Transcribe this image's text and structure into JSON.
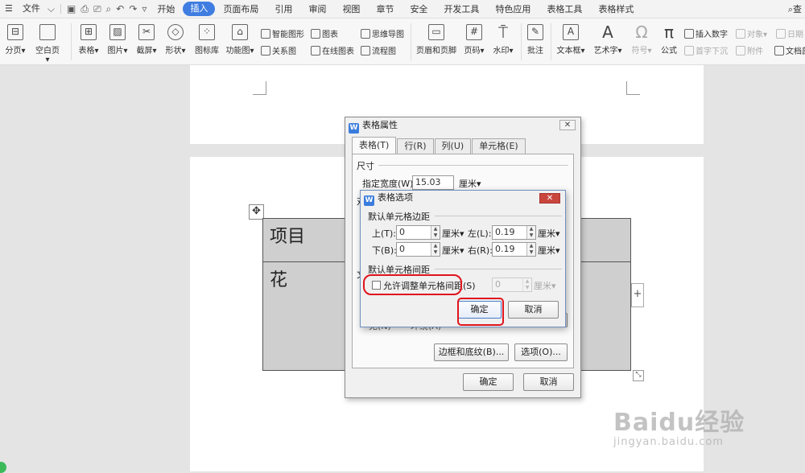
{
  "menubar": {
    "hamburger_icon": "menu-icon",
    "file_menu": "文件",
    "tabs": [
      "开始",
      "插入",
      "页面布局",
      "引用",
      "审阅",
      "视图",
      "章节",
      "安全",
      "开发工具",
      "特色应用",
      "表格工具",
      "表格样式"
    ],
    "active_tab": "插入",
    "search_label": "查"
  },
  "ribbon": {
    "page_break": "分页",
    "blank_page": "空白页",
    "table": "表格",
    "picture": "图片",
    "screenshot": "截屏",
    "shapes": "形状",
    "icon_library": "图标库",
    "function_chart": "功能图",
    "smart_shape": "智能图形",
    "chart": "图表",
    "relation_chart": "关系图",
    "online_chart": "在线图表",
    "mind_map": "思维导图",
    "flowchart": "流程图",
    "header_footer": "页眉和页脚",
    "page_number": "页码",
    "watermark": "水印",
    "comment": "批注",
    "text_box": "文本框",
    "art_text": "艺术字",
    "symbol": "符号",
    "formula": "公式",
    "insert_number": "插入数字",
    "drop_cap": "首字下沉",
    "object": "对象",
    "attachment": "附件",
    "date": "日期",
    "doc_part": "文档部"
  },
  "document": {
    "table_cell_1": "项目",
    "table_cell_2": "花"
  },
  "table_properties": {
    "title": "表格属性",
    "tabs": [
      "表格(T)",
      "行(R)",
      "列(U)",
      "单元格(E)"
    ],
    "size_label": "尺寸",
    "width_label": "指定宽度(W):",
    "width_value": "15.03",
    "width_unit": "厘米▾",
    "truncated_label_1": "对",
    "truncated_label_2": "文",
    "truncated_text_3": "无(N)",
    "truncated_text_4": "环绕(A)",
    "borders_button": "边框和底纹(B)...",
    "options_button": "选项(O)...",
    "ok_button": "确定",
    "cancel_button": "取消"
  },
  "table_options": {
    "title": "表格选项",
    "margins_label": "默认单元格边距",
    "top_label": "上(T):",
    "top_value": "0",
    "bottom_label": "下(B):",
    "bottom_value": "0",
    "left_label": "左(L):",
    "left_value": "0.19",
    "right_label": "右(R):",
    "right_value": "0.19",
    "unit": "厘米▾",
    "spacing_label": "默认单元格间距",
    "allow_spacing_label": "允许调整单元格间距(S)",
    "allow_spacing_checked": false,
    "spacing_value": "0",
    "spacing_unit": "厘米▾",
    "ok_button": "确定",
    "cancel_button": "取消"
  },
  "watermark": {
    "brand": "Baidu经验",
    "url": "jingyan.baidu.com"
  },
  "colors": {
    "accent": "#3f7de0",
    "highlight": "#e0141c",
    "table_fill": "#cfcfcf"
  }
}
